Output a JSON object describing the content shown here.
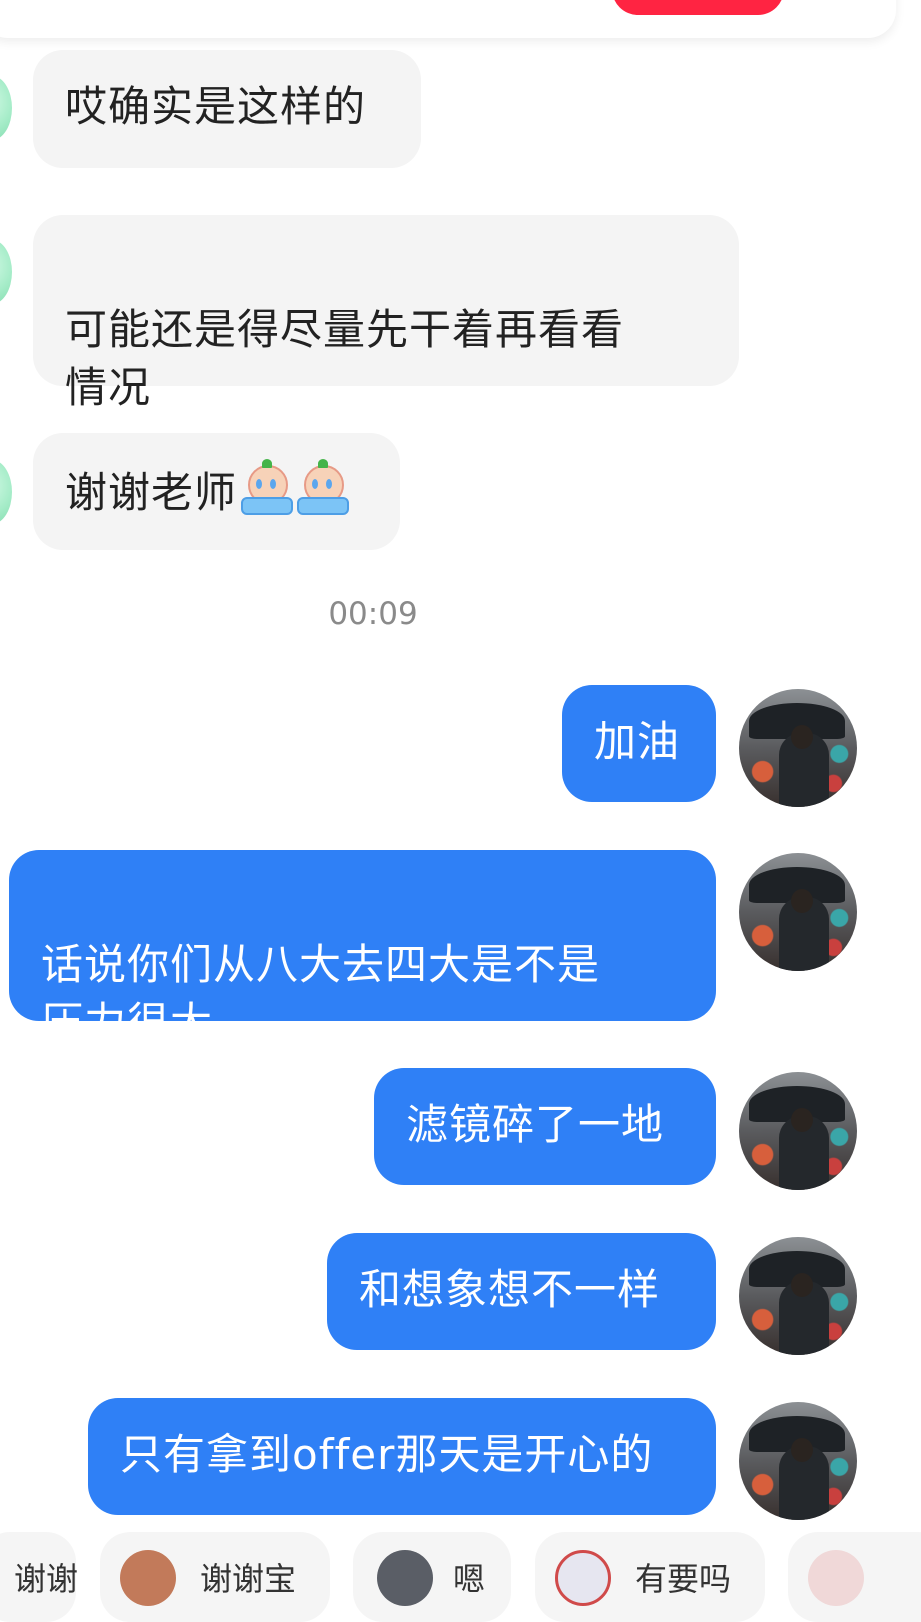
{
  "messages": [
    {
      "side": "in",
      "text": "哎确实是这样的"
    },
    {
      "side": "in",
      "text": "可能还是得尽量先干着再看看\n情况"
    },
    {
      "side": "in",
      "text": "谢谢老师"
    },
    {
      "side": "out",
      "text": "加油"
    },
    {
      "side": "out",
      "text": "话说你们从八大去四大是不是\n压力很大"
    },
    {
      "side": "out",
      "text": "滤镜碎了一地"
    },
    {
      "side": "out",
      "text": "和想象想不一样"
    },
    {
      "side": "out",
      "text": "只有拿到offer那天是开心的"
    }
  ],
  "timestamp": "00:09",
  "emoji_names": [
    "crying-emoji",
    "crying-emoji"
  ],
  "quick_replies": [
    "谢谢",
    "谢谢宝",
    "嗯",
    "有要吗"
  ],
  "colors": {
    "outgoing_bubble": "#2f80f6",
    "incoming_bubble": "#f4f4f4",
    "brand_red": "#ff2442"
  }
}
